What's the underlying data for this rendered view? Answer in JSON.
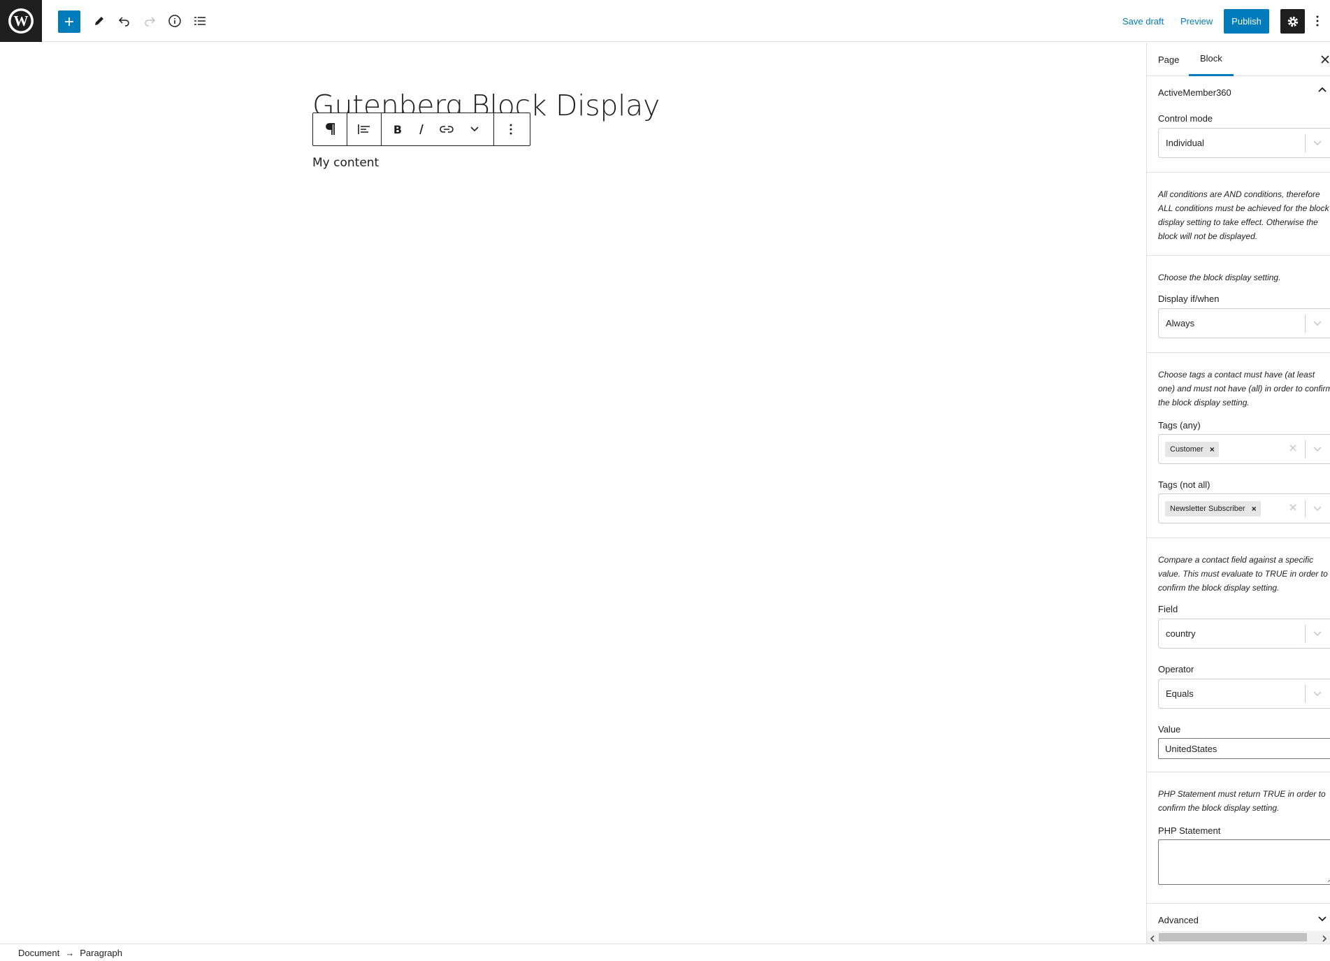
{
  "header": {
    "logo": "wordpress-logo",
    "save_draft": "Save draft",
    "preview": "Preview",
    "publish": "Publish"
  },
  "editor": {
    "title": "Gutenberg Block Display",
    "paragraph": "My content"
  },
  "footer": {
    "breadcrumb": [
      "Document",
      "Paragraph"
    ],
    "separator": "→"
  },
  "sidebar": {
    "tabs": [
      {
        "label": "Page",
        "active": false
      },
      {
        "label": "Block",
        "active": true
      }
    ],
    "panel_title": "ActiveMember360",
    "control_mode": {
      "label": "Control mode",
      "value": "Individual"
    },
    "help_and": "All conditions are AND conditions, therefore ALL conditions must be achieved for the block display setting to take effect. Otherwise the block will not be displayed.",
    "help_display": "Choose the block display setting.",
    "display_if": {
      "label": "Display if/when",
      "value": "Always"
    },
    "help_tags": "Choose tags a contact must have (at least one) and must not have (all) in order to confirm the block display setting.",
    "tags_any": {
      "label": "Tags (any)",
      "tag": "Customer",
      "remove": "×"
    },
    "tags_not_all": {
      "label": "Tags (not all)",
      "tag": "Newsletter Subscriber",
      "remove": "×"
    },
    "help_field": "Compare a contact field against a specific value. This must evaluate to TRUE in order to confirm the block display setting.",
    "field": {
      "label": "Field",
      "value": "country"
    },
    "operator": {
      "label": "Operator",
      "value": "Equals"
    },
    "value": {
      "label": "Value",
      "value": "UnitedStates"
    },
    "help_php": "PHP Statement must return TRUE in order to confirm the block display setting.",
    "php": {
      "label": "PHP Statement",
      "value": ""
    },
    "advanced": "Advanced"
  },
  "colors": {
    "accent": "#007cba",
    "dark": "#1e1e1e",
    "border": "#e0e0e0"
  }
}
